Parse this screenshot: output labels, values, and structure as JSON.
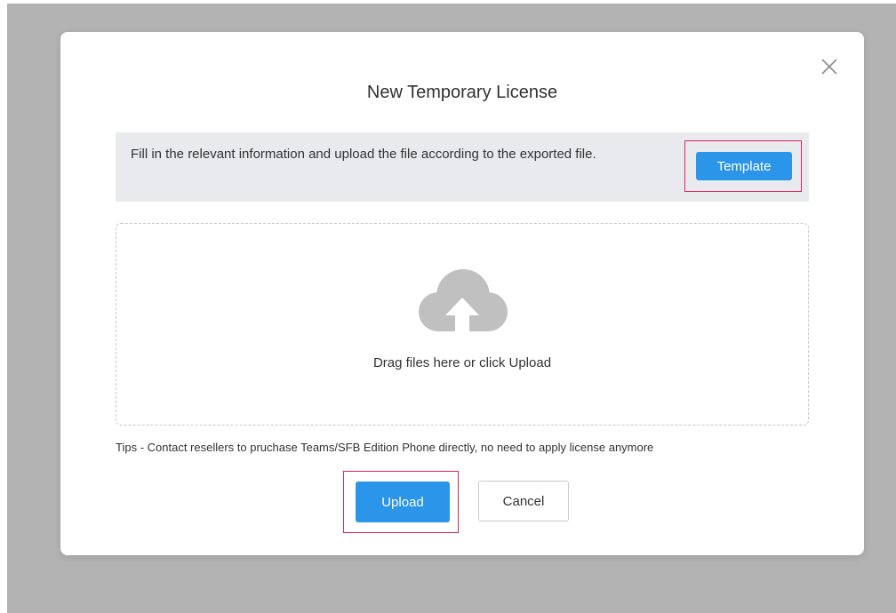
{
  "dialog": {
    "title": "New Temporary License",
    "notice_text": "Fill in the relevant information and upload the file according to the exported file.",
    "template_label": "Template",
    "dropzone_text": "Drag files here or click Upload",
    "tips": "Tips - Contact resellers to pruchase Teams/SFB Edition Phone directly, no need to apply license anymore",
    "upload_label": "Upload",
    "cancel_label": "Cancel"
  },
  "icons": {
    "close": "close-icon",
    "upload": "cloud-upload-icon"
  },
  "colors": {
    "primary": "#2b95e9",
    "highlight_border": "#e0245e",
    "notice_bg": "#e8eaed",
    "overlay": "#b3b3b3",
    "icon_gray": "#c0c0c0"
  }
}
